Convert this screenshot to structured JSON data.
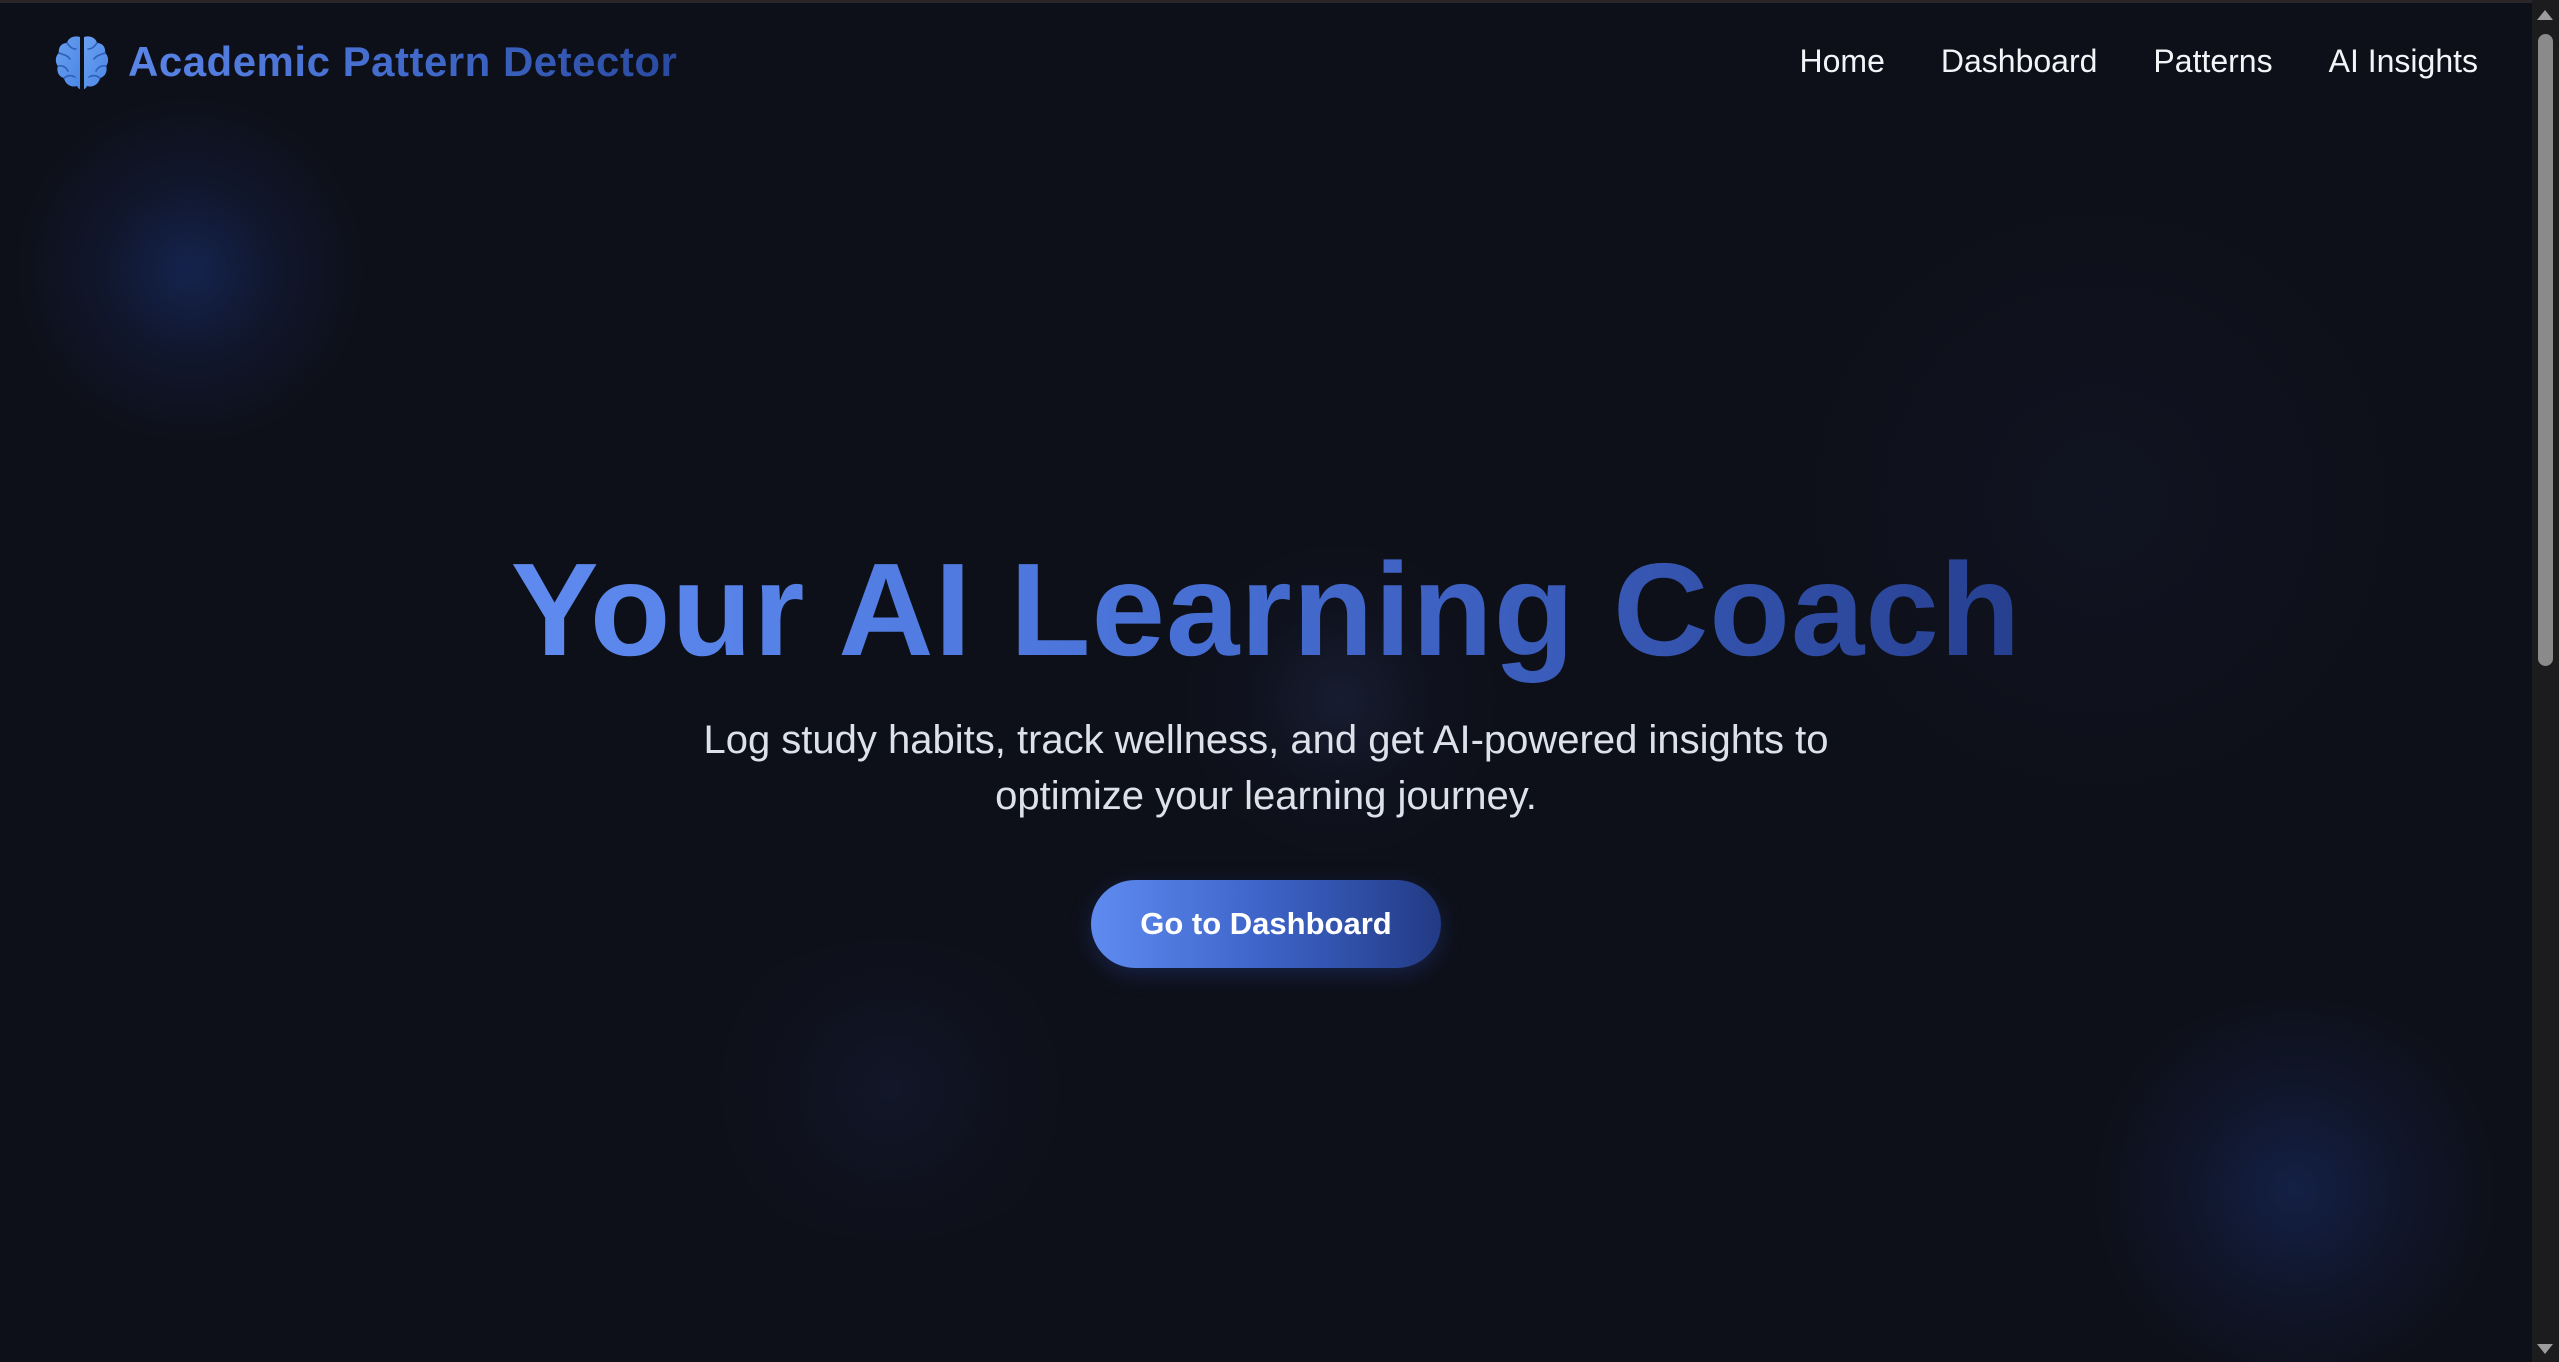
{
  "nav": {
    "brand_icon": "brain-icon",
    "brand_title": "Academic Pattern Detector",
    "links": [
      {
        "label": "Home"
      },
      {
        "label": "Dashboard"
      },
      {
        "label": "Patterns"
      },
      {
        "label": "AI Insights"
      }
    ]
  },
  "hero": {
    "title": "Your AI Learning Coach",
    "subtitle": "Log study habits, track wellness, and get AI-powered insights to optimize your learning journey.",
    "cta_label": "Go to Dashboard"
  },
  "colors": {
    "background": "#0e1019",
    "accent_start": "#5f8bf0",
    "accent_end": "#223a84",
    "nav_text": "#f2f4f8",
    "subtitle_text": "#dde2ea"
  }
}
